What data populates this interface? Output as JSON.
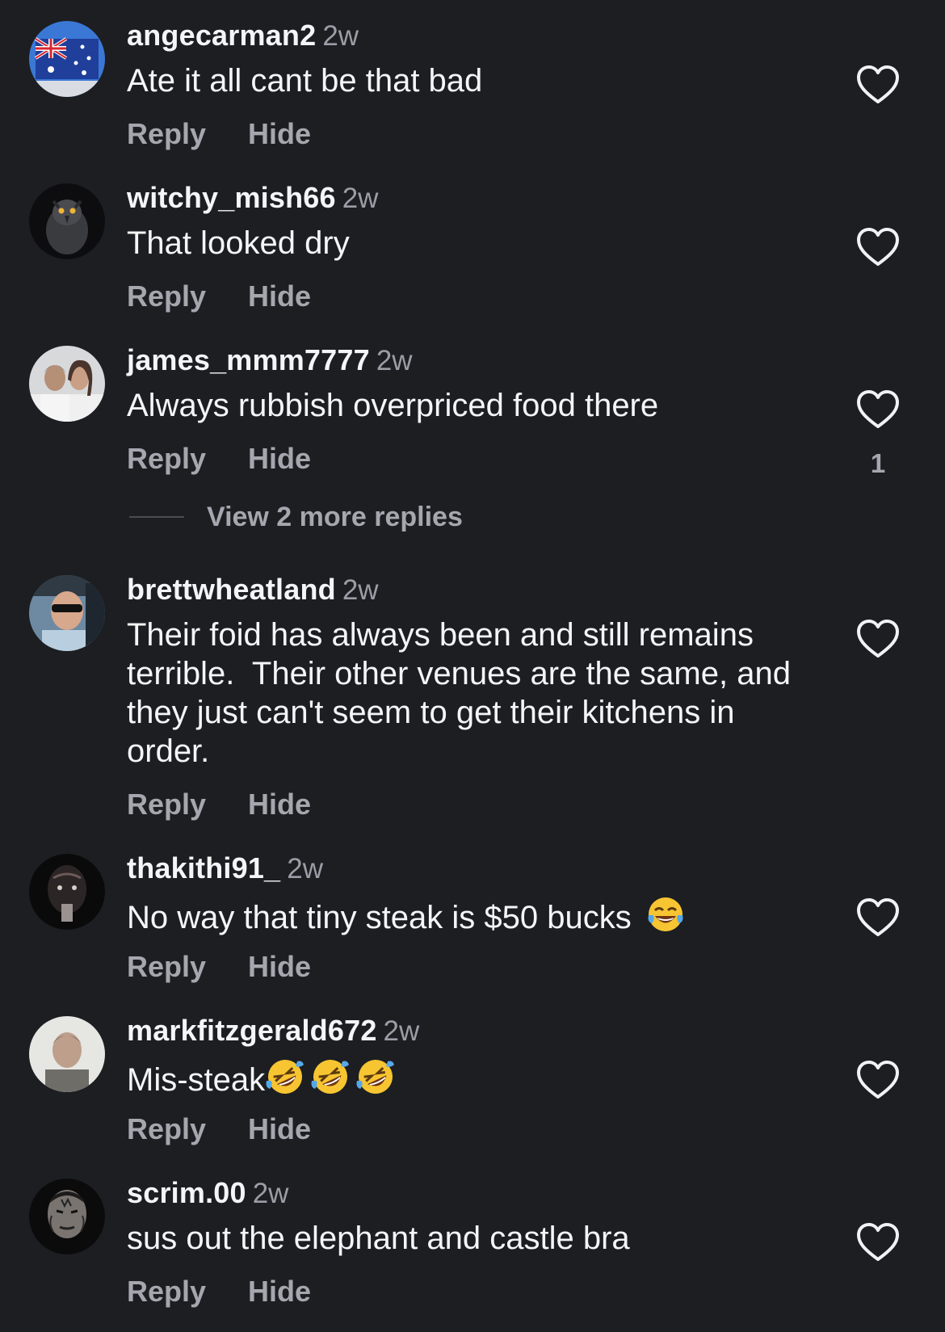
{
  "actions": {
    "reply_label": "Reply",
    "hide_label": "Hide"
  },
  "comments": [
    {
      "username": "angecarman2",
      "time": "2w",
      "text": "Ate it all cant be that bad",
      "avatar": "australia-flag-avatar",
      "like_count": ""
    },
    {
      "username": "witchy_mish66",
      "time": "2w",
      "text": "That looked dry",
      "avatar": "dark-bird-avatar",
      "like_count": ""
    },
    {
      "username": "james_mmm7777",
      "time": "2w",
      "text": "Always rubbish overpriced food there",
      "avatar": "couple-photo-avatar",
      "like_count": "1"
    },
    {
      "username": "brettwheatland",
      "time": "2w",
      "text": "Their foid has always been and still remains terrible.  Their other venues are the same, and they just can't seem to get their kitchens in order.",
      "avatar": "man-sunglasses-avatar",
      "like_count": ""
    },
    {
      "username": "thakithi91_",
      "time": "2w",
      "text": "No way that tiny steak is $50 bucks",
      "emojis": [
        "face-with-tears-of-joy"
      ],
      "avatar": "dark-face-avatar",
      "like_count": ""
    },
    {
      "username": "markfitzgerald672",
      "time": "2w",
      "text": "Mis-steak",
      "emojis": [
        "rolling-on-floor-laughing",
        "rolling-on-floor-laughing",
        "rolling-on-floor-laughing"
      ],
      "avatar": "blurred-man-avatar",
      "like_count": ""
    },
    {
      "username": "scrim.00",
      "time": "2w",
      "text": "sus out the elephant and castle bra",
      "avatar": "face-paint-avatar",
      "like_count": ""
    }
  ],
  "view_replies": {
    "label": "View 2 more replies"
  },
  "colors": {
    "background": "#1c1e22",
    "primary_text": "#f5f5f7",
    "secondary_text": "#a4a7ae",
    "timestamp": "#9b9ea6"
  },
  "icons": {
    "like": "heart-outline-icon"
  }
}
